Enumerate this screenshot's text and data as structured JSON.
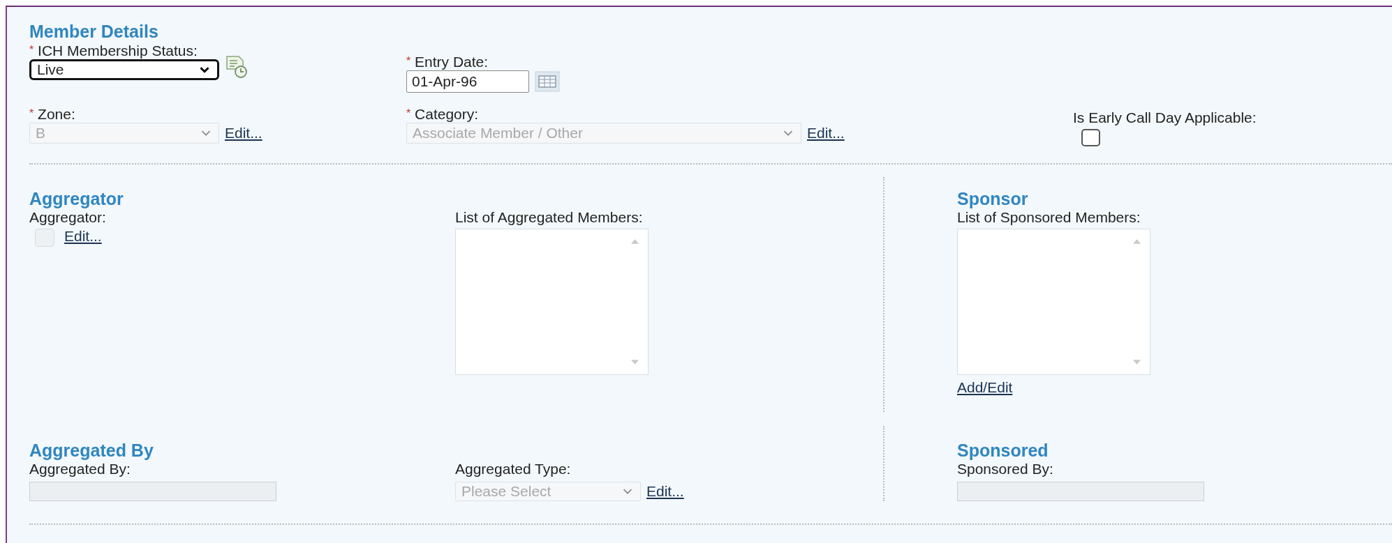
{
  "member_details": {
    "title": "Member Details",
    "membership_status": {
      "required_mark": "*",
      "label": "ICH Membership Status:",
      "value": "Live",
      "disabled": false
    },
    "entry_date": {
      "required_mark": "*",
      "label": "Entry Date:",
      "value": "01-Apr-96"
    },
    "zone": {
      "required_mark": "*",
      "label": "Zone:",
      "value": "B",
      "disabled": true,
      "edit_link": "Edit..."
    },
    "category": {
      "required_mark": "*",
      "label": "Category:",
      "value": "Associate Member / Other",
      "disabled": true,
      "edit_link": "Edit..."
    },
    "early_call_day": {
      "label": "Is Early Call Day Applicable:",
      "checked": false
    }
  },
  "aggregator": {
    "title": "Aggregator",
    "label": "Aggregator:",
    "checked": false,
    "disabled": true,
    "edit_link": "Edit...",
    "members_label": "List of Aggregated Members:"
  },
  "sponsor": {
    "title": "Sponsor",
    "members_label": "List of Sponsored Members:",
    "add_edit_link": "Add/Edit"
  },
  "aggregated_by": {
    "title": "Aggregated By",
    "label": "Aggregated By:",
    "disabled": true,
    "type": {
      "label": "Aggregated Type:",
      "placeholder": "Please Select",
      "disabled": true,
      "edit_link": "Edit..."
    }
  },
  "sponsored": {
    "title": "Sponsored",
    "label": "Sponsored By:",
    "disabled": true
  }
}
